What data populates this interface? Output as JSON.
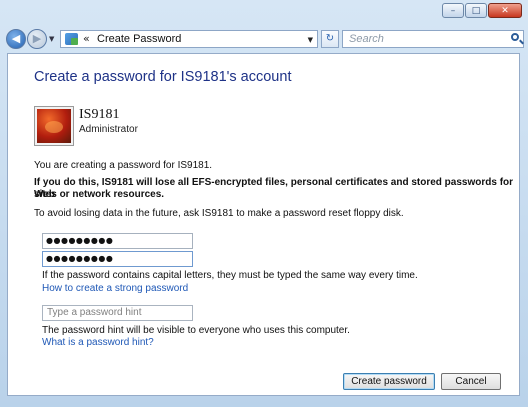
{
  "window": {
    "controls": {
      "minimize": "–",
      "maximize": "□",
      "close": "✕"
    }
  },
  "nav": {
    "back_glyph": "◀",
    "forward_glyph": "▶",
    "dropdown_glyph": "▼",
    "address": {
      "chevron": "«",
      "text": "Create Password",
      "dropdown_glyph": "▼",
      "icon": "control-panel-icon"
    },
    "refresh_glyph": "↻",
    "search": {
      "placeholder": "Search",
      "icon": "search-icon"
    }
  },
  "page": {
    "heading": "Create a password for IS9181's account",
    "user": {
      "name": "IS9181",
      "type": "Administrator"
    },
    "info_text": "You are creating a password for IS9181.",
    "warning_line1": "If you do this, IS9181 will lose all EFS-encrypted files, personal certificates and stored passwords for Web",
    "warning_line2": "sites or network resources.",
    "reset_text": "To avoid losing data in the future, ask IS9181 to make a password reset floppy disk.",
    "new_password": "●●●●●●●●●",
    "confirm_password": "●●●●●●●●●",
    "caps_note": "If the password contains capital letters, they must be typed the same way every time.",
    "strong_password_link": "How to create a strong password",
    "hint_placeholder": "Type a password hint",
    "hint_note": "The password hint will be visible to everyone who uses this computer.",
    "hint_link": "What is a password hint?",
    "create_button": "Create password",
    "cancel_button": "Cancel"
  },
  "colors": {
    "heading": "#1e3287",
    "link": "#1f58b6",
    "close_button": "#c7371f",
    "frame": "#b9d2ea"
  }
}
